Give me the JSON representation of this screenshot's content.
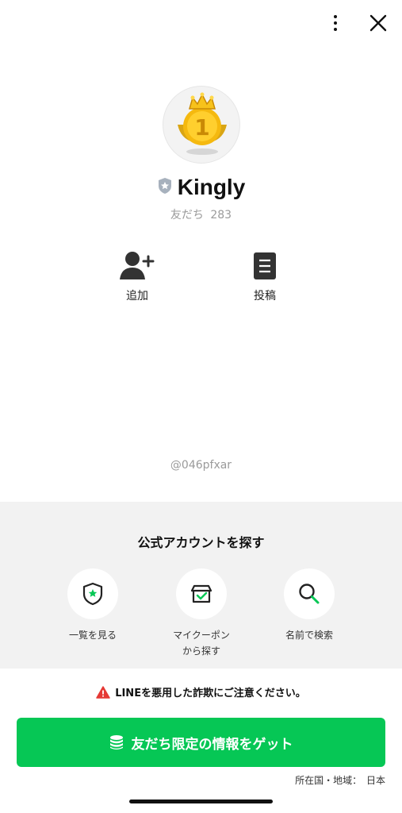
{
  "header": {
    "more_icon": "more-vertical-icon",
    "close_icon": "close-icon"
  },
  "profile": {
    "avatar_icon": "gold-crown-medal-icon",
    "badge_icon": "verified-shield-icon",
    "name": "Kingly",
    "friends_label": "友だち",
    "friends_count": "283",
    "actions": [
      {
        "label": "追加",
        "icon": "add-friend-icon"
      },
      {
        "label": "投稿",
        "icon": "post-document-icon"
      }
    ],
    "account_id": "@046pfxar"
  },
  "search_section": {
    "title": "公式アカウントを探す",
    "items": [
      {
        "label": "一覧を見る",
        "icon": "shield-star-icon"
      },
      {
        "label_line1": "マイクーポン",
        "label_line2": "から探す",
        "icon": "coupon-icon"
      },
      {
        "label": "名前で検索",
        "icon": "search-icon"
      }
    ]
  },
  "warning": {
    "icon": "warning-triangle-icon",
    "text": "LINEを悪用した詐欺にご注意ください。",
    "color": "#e53935"
  },
  "cta": {
    "label": "友だち限定の情報をゲット",
    "icon": "coin-stack-icon",
    "color": "#06c755"
  },
  "region": {
    "label": "所在国・地域：",
    "value": "日本"
  }
}
